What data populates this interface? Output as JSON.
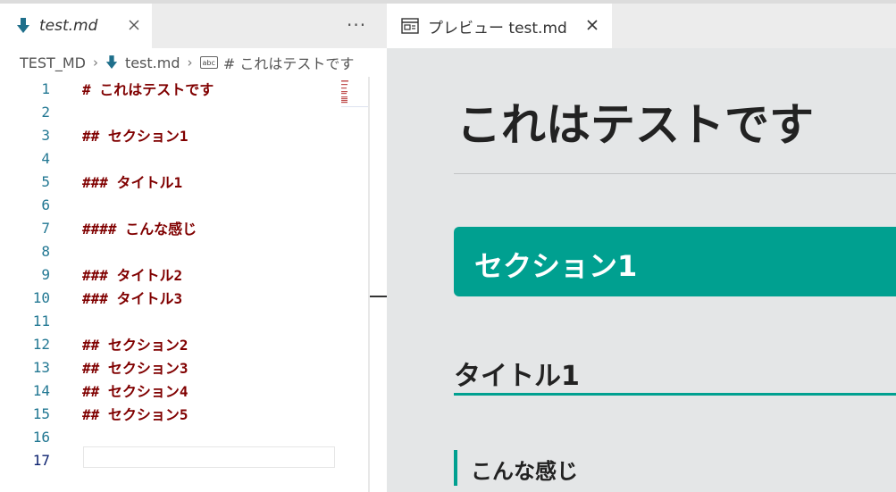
{
  "editor": {
    "tab": {
      "label": "test.md",
      "icon": "markdown-file-icon"
    },
    "more_actions": "···",
    "breadcrumb": {
      "folder": "TEST_MD",
      "file": "test.md",
      "abc_icon": "abc",
      "symbol": "# これはテストです"
    },
    "lines": [
      {
        "num": "1",
        "text": "# これはテストです"
      },
      {
        "num": "2",
        "text": ""
      },
      {
        "num": "3",
        "text": "## セクション1"
      },
      {
        "num": "4",
        "text": ""
      },
      {
        "num": "5",
        "text": "### タイトル1"
      },
      {
        "num": "6",
        "text": ""
      },
      {
        "num": "7",
        "text": "#### こんな感じ"
      },
      {
        "num": "8",
        "text": ""
      },
      {
        "num": "9",
        "text": "### タイトル2"
      },
      {
        "num": "10",
        "text": "### タイトル3"
      },
      {
        "num": "11",
        "text": ""
      },
      {
        "num": "12",
        "text": "## セクション2"
      },
      {
        "num": "13",
        "text": "## セクション3"
      },
      {
        "num": "14",
        "text": "## セクション4"
      },
      {
        "num": "15",
        "text": "## セクション5"
      },
      {
        "num": "16",
        "text": ""
      },
      {
        "num": "17",
        "text": ""
      }
    ],
    "colors": {
      "line_number": "#237893",
      "heading_text": "#800000"
    }
  },
  "preview": {
    "tab": {
      "label": "プレビュー test.md",
      "icon": "preview-icon"
    },
    "h1": "これはテストです",
    "h2": "セクション1",
    "h3": "タイトル1",
    "h4": "こんな感じ",
    "colors": {
      "accent": "#00a090",
      "background": "#e4e6e7"
    }
  }
}
